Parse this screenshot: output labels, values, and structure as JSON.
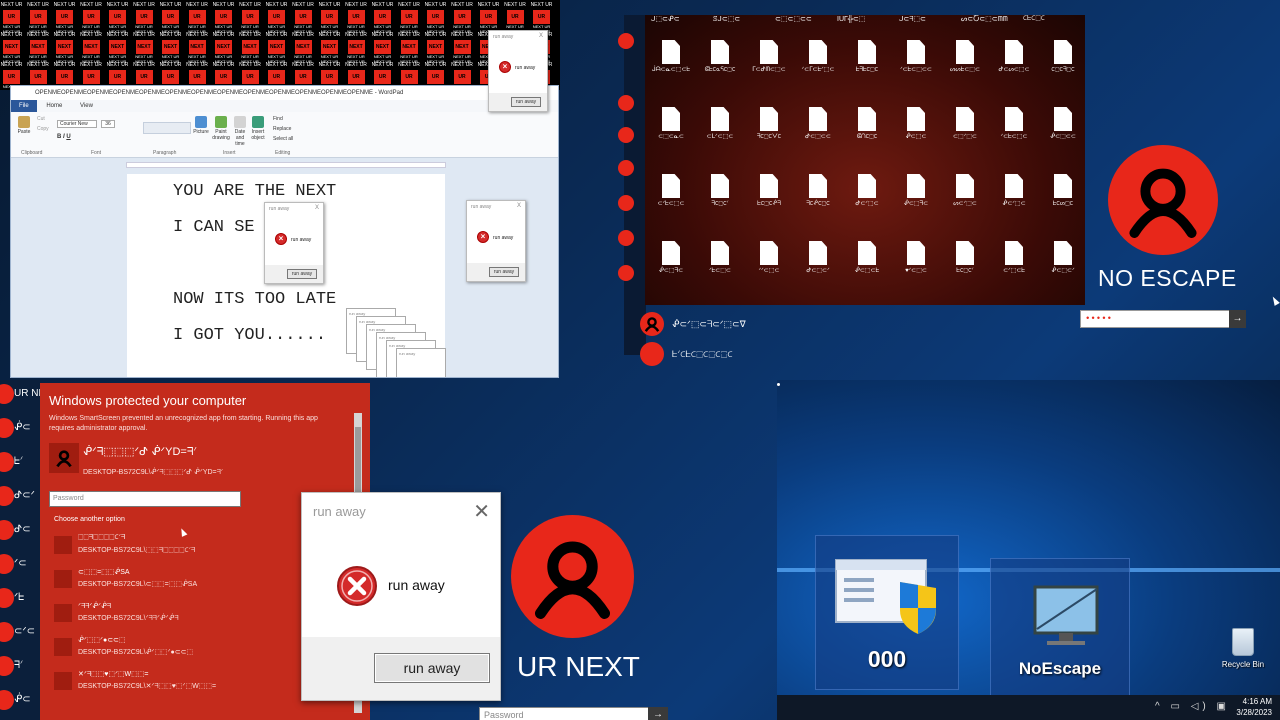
{
  "tiles": {
    "top": "NEXT UR",
    "box": "UR",
    "box2": "NEXT",
    "bottom": "NEXT UR NEXT UR"
  },
  "wordpad": {
    "title": "OPENMEOPENMEOPENMEOPENMEOPENMEOPENMEOPENMEOPENMEOPENMEOPENMEOPENMEOPENMEOPENME - WordPad",
    "tabs": [
      "File",
      "Home",
      "View"
    ],
    "ribbon": {
      "paste": "Paste",
      "cut": "Cut",
      "copy": "Copy",
      "font_name": "Courier New",
      "font_size": "36",
      "picture": "Picture",
      "paint": "Paint drawing",
      "datetime": "Date and time",
      "insert_object": "Insert object",
      "find": "Find",
      "replace": "Replace",
      "select_all": "Select all",
      "groups": [
        "Clipboard",
        "Font",
        "Paragraph",
        "Insert",
        "Editing"
      ]
    },
    "lines": [
      "YOU ARE THE NEXT",
      "I CAN SE",
      "NOW ITS TOO LATE",
      "I GOT YOU......"
    ]
  },
  "mini_dialog": {
    "title": "run away",
    "message": "run away",
    "button": "run away",
    "close": "X"
  },
  "file_desktop": {
    "top_labels": [
      "ᒎ⬚⊂ᕶ⊂",
      "ꕷᒎ⊂⬚⊂",
      "⊂⬚⊂⬚⊂⊂",
      "IUΓ╬⊂⬚",
      "ᒎ⊂ᖷ⬚⊂",
      "ᔕ⊂Ⴀ⊂⬚⊂ᗰᗰ",
      "⊂ᖶ⊂⬚⊂"
    ],
    "rows": [
      [
        "ᒎᗩ⊂ᓇ⊂⬚⊂ᖶ",
        "ᕳᖶ⊂ᓇᕋ⊂⬚⊂",
        "ᒥ⊂ᕷᗰ⊂⬚⊂",
        "ᐟ⊂ᒥ⊂ᖶᐟ⬚⊂",
        "ᖶᖷᖶ⊂⬚⊂",
        "ᐟ⊂ᖶ⊂⬚⊂⊂",
        "ᔕᔕᖶ⊂⬚⊂",
        "ᕷ⊂ᔕ⊂⬚⊂",
        "⊂⬚⊂ᖷ⬚⊂"
      ],
      [
        "⊂⬚⊂ᓇ⊂",
        "⊂ᒪᐟ⊂⬚⊂",
        "ᖷ⊂⬚⊂ᐯ⊂",
        "ᕷ⊂⬚⊂⊂",
        "ᕳᑎ⊂⬚⊂",
        "ᕶ⊂⬚⊂",
        "⊂⬚ᐟ⬚⊂",
        "ᐟ⊂ᖶ⊂⬚⊂",
        "ᕶ⊂⬚⊂⊂"
      ],
      [
        "⊂ᐟᖶ⊂⬚⊂",
        "ᖷ⊂⬚⊂ᐟ",
        "ᖶ⊂⬚⊂ᕶᖷ",
        "ᖷ⊂ᕶ⊂⬚⊂",
        "ᕷ⊂ᐟ⬚⊂",
        "ᕶ⊂⬚ᖷ⊂",
        "ᔕ⊂ᐟ⬚⊂",
        "ᕶ⊂ᐟ⬚⊂",
        "ᖶ⊂ᔕ⬚⊂"
      ],
      [
        "ᕶ⊂⬚ᖷ⊂",
        "ᐟᖶ⊂⬚⊂",
        "ᐟᐟ⊂⬚⊂",
        "ᕷ⊂⬚⊂ᐟ",
        "ᕶ⊂⬚⊂ᖶ",
        "♥ᐟ⊂⬚⊂",
        "ᖶ⊂⬚⊂ᐟ",
        "⊂ᐟ⬚⊂ᖶ",
        "ᕶ⊂⬚⊂ᐟ"
      ]
    ]
  },
  "no_escape_login": {
    "name": "NO ESCAPE",
    "password_mask": "•••••",
    "submit": "→"
  },
  "mid_users": [
    {
      "name": "ᕶ⊂ᐟ⬚⊂ᖷ⊂ᐟ⬚⊂ᐁ"
    },
    {
      "name": "ᖶᐟ⊂ᖶ⊂⬚⊂⬚⊂⬚⊂"
    }
  ],
  "left_users": [
    "UR NE",
    "ᕶ⊂",
    "ᖶᐟ",
    "ᕷ⊂ᐟ",
    "ᕷ⊂",
    "ᐟ⊂",
    "ᐟᖶ",
    "⊂ᐟ⊂",
    "ᖷᐟ",
    "ᕶ⊂"
  ],
  "smartscreen": {
    "title": "Windows protected your computer",
    "desc": "Windows SmartScreen prevented an unrecognized app from starting. Running this app requires administrator approval.",
    "main_name": "ᕶᐟᖷ⬚⬚⬚ᐟᕷ ᕶᐟYD=ᖷᐟ",
    "main_sub": "DESKTOP-BS72C9L\\ᕶᐟᖷ⬚⬚⬚ᐟᕷ ᕶᐟYD=ᖷᐟ",
    "password_placeholder": "Password",
    "another": "Choose another option",
    "options": [
      {
        "name": "⬚⬚ᖷ⬚⬚⬚⬚⊂ᐟᖷ",
        "sub": "DESKTOP-BS72C9L\\⬚⬚ᖷ⬚⬚⬚⬚⊂ᐟᖷ"
      },
      {
        "name": "⊂⬚⬚=⬚⬚ᕶSA",
        "sub": "DESKTOP-BS72C9L\\⊂⬚⬚=⬚⬚ᕶSA"
      },
      {
        "name": "ᐟᖷᖷᐟᕶᐟᕶᖷ",
        "sub": "DESKTOP-BS72C9L\\ᐟᖷᖷᐟᕶᐟᕶᖷ"
      },
      {
        "name": "ᕶᐟ⬚⬚ᐟ●⊂⊂⬚",
        "sub": "DESKTOP-BS72C9L\\ᕶᐟ⬚⬚ᐟ●⊂⊂⬚"
      },
      {
        "name": "✕ᐟᖷ⬚⬚♥⬚ᐟ⬚W⬚⬚=",
        "sub": "DESKTOP-BS72C9L\\✕ᐟᖷ⬚⬚♥⬚ᐟ⬚W⬚⬚="
      }
    ]
  },
  "big_dialog": {
    "title": "run away",
    "close": "✕",
    "message": "run away",
    "button": "run away"
  },
  "ur_next_login": {
    "name": "UR NEXT",
    "password_placeholder": "Password",
    "submit": "→"
  },
  "shortcuts": [
    {
      "label": "000"
    },
    {
      "label": "NoEscape"
    }
  ],
  "recycle_bin": {
    "label": "Recycle Bin"
  },
  "taskbar": {
    "tray": "^ ▭ ◁) ▣",
    "time": "4:16 AM",
    "date": "3/28/2023"
  },
  "colors": {
    "accent_red": "#e8271a",
    "smartscreen_red": "#c42b1c"
  }
}
